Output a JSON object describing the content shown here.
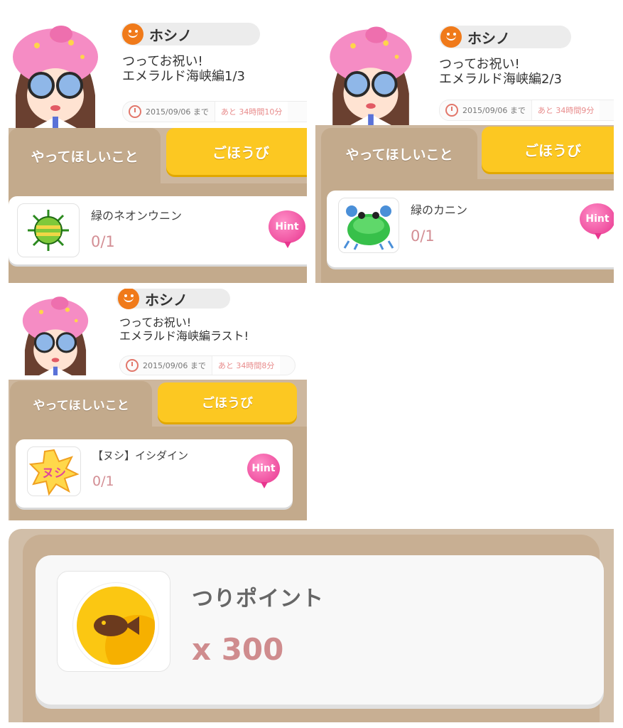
{
  "missions": [
    {
      "user_name": "ホシノ",
      "title": "つってお祝い!\nエメラルド海峡編1/3",
      "deadline": "2015/09/06 まで",
      "remaining": "あと 34時間10分",
      "tab_task": "やってほしいこと",
      "tab_reward": "ごほうび",
      "item_name": "緑のネオンウニン",
      "item_count": "0/1",
      "hint": "Hint"
    },
    {
      "user_name": "ホシノ",
      "title": "つってお祝い!\nエメラルド海峡編2/3",
      "deadline": "2015/09/06 まで",
      "remaining": "あと 34時間9分",
      "tab_task": "やってほしいこと",
      "tab_reward": "ごほうび",
      "item_name": "緑のカニン",
      "item_count": "0/1",
      "hint": "Hint"
    },
    {
      "user_name": "ホシノ",
      "title": "つってお祝い!\nエメラルド海峡編ラスト!",
      "deadline": "2015/09/06 まで",
      "remaining": "あと 34時間8分",
      "tab_task": "やってほしいこと",
      "tab_reward": "ごほうび",
      "item_name": "【ヌシ】イシダイン",
      "item_count": "0/1",
      "hint": "Hint",
      "thumb_text": "ヌシ"
    }
  ],
  "reward": {
    "name": "つりポイント",
    "amount": "x 300"
  },
  "colors": {
    "tab_tan": "#c3aa8c",
    "reward_yellow": "#fcc822",
    "hint_pink": "#e8358e",
    "count_pink": "#d38e94"
  }
}
